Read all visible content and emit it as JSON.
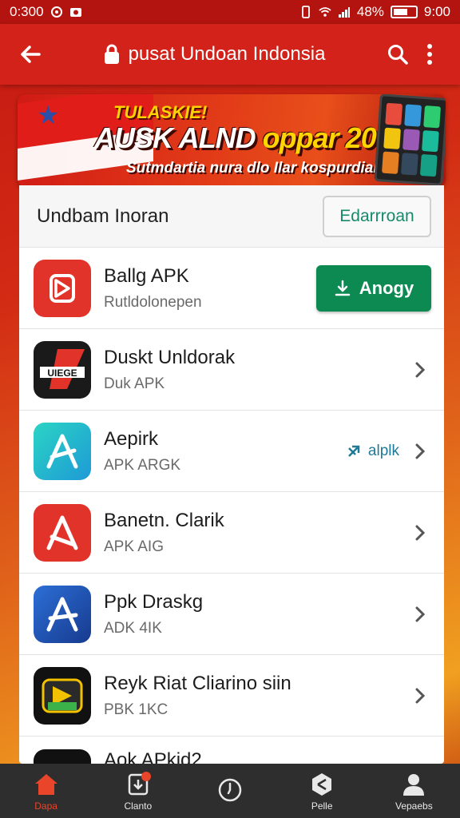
{
  "status_bar": {
    "time_left": "0:300",
    "battery_pct": "48%",
    "time_right": "9:00"
  },
  "app_bar": {
    "title": "pusat Undoan Indonsia"
  },
  "banner": {
    "kicker": "TULASKIE!",
    "headline_a": "AUSK ALND ",
    "headline_b": "oppar 20N!",
    "subtitle": "Sutmdartia nura dlo Ilar kospurdian"
  },
  "panel": {
    "title": "Undbam Inoran",
    "header_button": "Edarrroan"
  },
  "apps": [
    {
      "name": "Ballg APK",
      "sub": "Rutldolonepen",
      "action": "Anogy"
    },
    {
      "name": "Duskt Unldorak",
      "sub": "Duk APK",
      "icon_text": "UIEGE"
    },
    {
      "name": "Aepirk",
      "sub": "APK ARGK",
      "tag": "alplk"
    },
    {
      "name": "Banetn. Clarik",
      "sub": "APK AIG"
    },
    {
      "name": "Ppk Draskg",
      "sub": "ADK 4IK"
    },
    {
      "name": "Reyk Riat Cliarino siin",
      "sub": "PBK 1KC"
    },
    {
      "name": "Aok APkid2",
      "sub": ""
    }
  ],
  "bottom_nav": [
    {
      "label": "Dapa",
      "icon": "home-icon"
    },
    {
      "label": "Clanto",
      "icon": "download-icon"
    },
    {
      "label": "",
      "icon": "clock-icon"
    },
    {
      "label": "Pelle",
      "icon": "settings-icon"
    },
    {
      "label": "Vepaebs",
      "icon": "user-icon"
    }
  ],
  "colors": {
    "primary": "#d3221a",
    "install": "#0c8a52",
    "nav_bg": "#2e2e2e",
    "active": "#e8452a"
  }
}
